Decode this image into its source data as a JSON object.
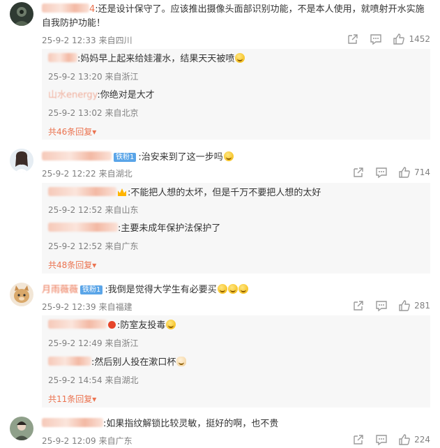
{
  "comments": [
    {
      "text": ":还是设计保守了。应该推出摄像头面部识别功能，不是本人使用，就喷射开水实施自我防护功能！",
      "time": "25-9-2 12:33",
      "location": "来自四川",
      "likes": "1452",
      "replies": [
        {
          "text": ":妈妈早上起来给娃灌水，结果天天被喷",
          "time": "25-9-2 13:20",
          "location": "来自浙江"
        },
        {
          "username": "山水energy",
          "text": ":你绝对是大才",
          "time": "25-9-2 13:02",
          "location": "来自北京"
        }
      ],
      "more": "共46条回复"
    },
    {
      "vip": "铁粉1",
      "text": ":治安来到了这一步吗",
      "time": "25-9-2 12:22",
      "location": "来自湖北",
      "likes": "714",
      "replies": [
        {
          "text": ":不能把人想的太坏，但是千万不要把人想的太好",
          "time": "25-9-2 12:52",
          "location": "来自山东"
        },
        {
          "text": ":主要未成年保护法保护了",
          "time": "25-9-2 12:52",
          "location": "来自广东"
        }
      ],
      "more": "共48条回复"
    },
    {
      "username": "月雨薇薇",
      "vip": "铁粉1",
      "text": ":我倒是觉得大学生有必要买",
      "time": "25-9-2 12:39",
      "location": "来自福建",
      "likes": "281",
      "replies": [
        {
          "text": ":防室友投毒",
          "time": "25-9-2 12:49",
          "location": "来自浙江"
        },
        {
          "text": ":然后别人投在漱口杯",
          "time": "25-9-2 14:54",
          "location": "来自湖北"
        }
      ],
      "more": "共11条回复"
    },
    {
      "text": ":如果指纹解锁比较灵敏，挺好的啊，也不贵",
      "time": "25-9-2 12:09",
      "location": "来自广东",
      "likes": "224"
    }
  ],
  "colors": {
    "accent": "#eb7350",
    "meta": "#808080",
    "reply_bg": "#f7f7f7",
    "vip": "#5aa5e8"
  },
  "icons": {
    "share": "share-icon",
    "comment": "comment-icon",
    "like": "thumbs-up-icon",
    "expand": "caret-down-icon"
  }
}
